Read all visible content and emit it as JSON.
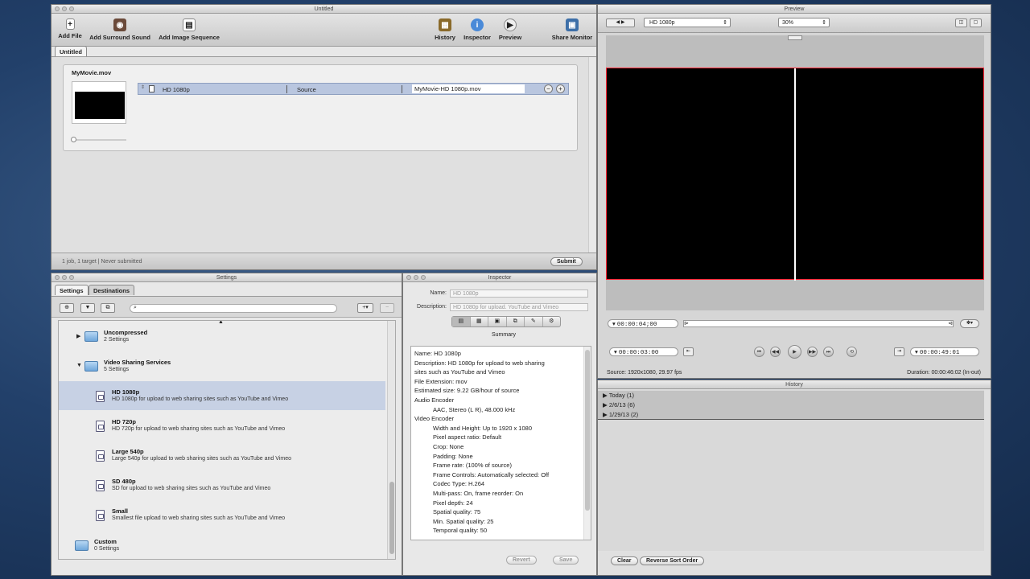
{
  "batch_window": {
    "title": "Untitled",
    "toolbar": {
      "add_file": "Add File",
      "add_surround": "Add Surround Sound",
      "add_image_sequence": "Add Image Sequence",
      "history": "History",
      "inspector": "Inspector",
      "preview": "Preview",
      "share_monitor": "Share Monitor"
    },
    "tab_label": "Untitled",
    "job": {
      "file_name": "MyMovie.mov",
      "setting": "HD 1080p",
      "destination": "Source",
      "output_file": "MyMovie-HD 1080p.mov"
    },
    "status_text": "1 job, 1 target  |  Never submitted",
    "submit_label": "Submit"
  },
  "settings_window": {
    "title": "Settings",
    "tabs": [
      "Settings",
      "Destinations"
    ],
    "search_placeholder": "",
    "groups": [
      {
        "name": "Uncompressed",
        "count": "2 Settings",
        "expanded": false
      },
      {
        "name": "Video Sharing Services",
        "count": "5 Settings",
        "expanded": true
      }
    ],
    "items": [
      {
        "title": "HD 1080p",
        "desc": "HD 1080p for upload to web sharing sites such as YouTube and Vimeo",
        "selected": true
      },
      {
        "title": "HD 720p",
        "desc": "HD 720p for upload to web sharing sites such as YouTube and Vimeo",
        "selected": false
      },
      {
        "title": "Large 540p",
        "desc": "Large 540p for upload to web sharing sites such as YouTube and Vimeo",
        "selected": false
      },
      {
        "title": "SD 480p",
        "desc": "SD for upload to web sharing sites such as YouTube and Vimeo",
        "selected": false
      },
      {
        "title": "Small",
        "desc": "Smallest file upload to web sharing sites such as YouTube and Vimeo",
        "selected": false
      }
    ],
    "custom_group": {
      "name": "Custom",
      "count": "0 Settings"
    }
  },
  "inspector_window": {
    "title": "Inspector",
    "name_label": "Name:",
    "name_value": "HD 1080p",
    "description_label": "Description:",
    "description_value": "HD 1080p for upload. YouTube and Vimeo",
    "summary_tab": "Summary",
    "summary_lines": [
      {
        "text": "Name: HD 1080p",
        "indent": false
      },
      {
        "text": "Description: HD 1080p for upload to web sharing",
        "indent": false
      },
      {
        "text": "sites such as YouTube and Vimeo",
        "indent": false
      },
      {
        "text": "File Extension: mov",
        "indent": false
      },
      {
        "text": "Estimated size: 9.22 GB/hour of source",
        "indent": false
      },
      {
        "text": "Audio Encoder",
        "indent": false
      },
      {
        "text": "AAC, Stereo (L R), 48.000 kHz",
        "indent": true
      },
      {
        "text": "Video Encoder",
        "indent": false
      },
      {
        "text": "Width and Height: Up to 1920 x 1080",
        "indent": true
      },
      {
        "text": "Pixel aspect ratio: Default",
        "indent": true
      },
      {
        "text": "Crop: None",
        "indent": true
      },
      {
        "text": "Padding: None",
        "indent": true
      },
      {
        "text": "Frame rate: (100% of source)",
        "indent": true
      },
      {
        "text": "Frame Controls: Automatically selected: Off",
        "indent": true
      },
      {
        "text": "Codec Type: H.264",
        "indent": true
      },
      {
        "text": "Multi-pass: On, frame reorder: On",
        "indent": true
      },
      {
        "text": "Pixel depth: 24",
        "indent": true
      },
      {
        "text": "Spatial quality: 75",
        "indent": true
      },
      {
        "text": "Min. Spatial quality: 25",
        "indent": true
      },
      {
        "text": "Temporal quality: 50",
        "indent": true
      }
    ],
    "revert_label": "Revert",
    "save_label": "Save"
  },
  "preview_window": {
    "title": "Preview",
    "setting_select": "HD 1080p",
    "zoom_select": "30%",
    "current_timecode": "00:00:04;00",
    "in_timecode": "00:00:03:00",
    "out_timecode": "00:00:49:01",
    "source_info": "Source: 1920x1080, 29.97 fps",
    "duration_info": "Duration: 00:00:46:02 (In-out)"
  },
  "history_window": {
    "title": "History",
    "rows": [
      "Today (1)",
      "2/6/13 (6)",
      "1/29/13 (2)"
    ],
    "clear_label": "Clear",
    "reverse_label": "Reverse Sort Order"
  },
  "colors": {
    "selection": "#c7d1e4",
    "preview_border": "#ff2a3a",
    "desktop": "#22406a"
  }
}
